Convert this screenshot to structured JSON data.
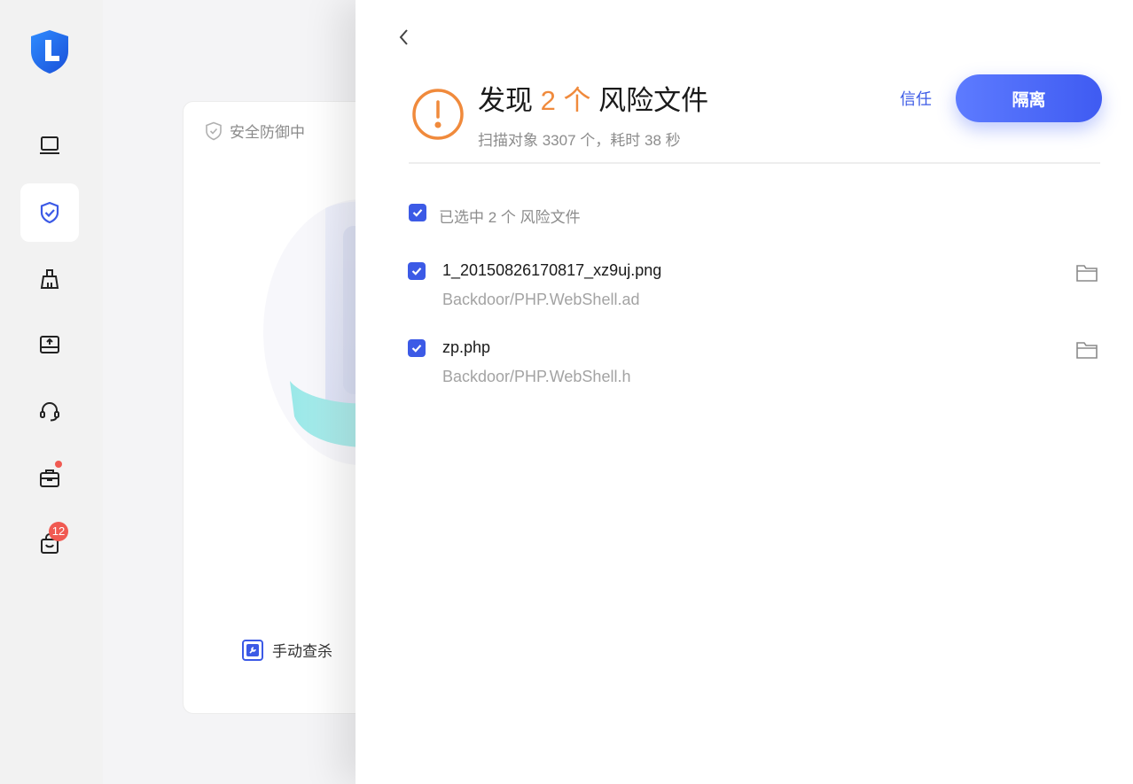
{
  "sidebar": {
    "items": [
      {
        "icon": "laptop-icon"
      },
      {
        "icon": "shield-check-icon",
        "active": true
      },
      {
        "icon": "broom-icon"
      },
      {
        "icon": "upload-drive-icon"
      },
      {
        "icon": "headset-icon"
      },
      {
        "icon": "briefcase-icon",
        "has_dot": true
      },
      {
        "icon": "shopping-bag-icon",
        "badge": "12"
      }
    ]
  },
  "background_card": {
    "status_label": "安全防御中",
    "manual_scan_label": "手动查杀"
  },
  "panel": {
    "headline_prefix": "发现",
    "headline_count": "2 个",
    "headline_suffix": "风险文件",
    "subline": "扫描对象 3307 个，耗时 38 秒",
    "trust_label": "信任",
    "isolate_label": "隔离",
    "select_all_label": "已选中 2 个 风险文件",
    "files": [
      {
        "name": "1_20150826170817_xz9uj.png",
        "threat": "Backdoor/PHP.WebShell.ad",
        "checked": true
      },
      {
        "name": "zp.php",
        "threat": "Backdoor/PHP.WebShell.h",
        "checked": true
      }
    ]
  },
  "colors": {
    "accent": "#3c5ae6",
    "warning": "#f08a3c",
    "badge": "#f05a52"
  }
}
